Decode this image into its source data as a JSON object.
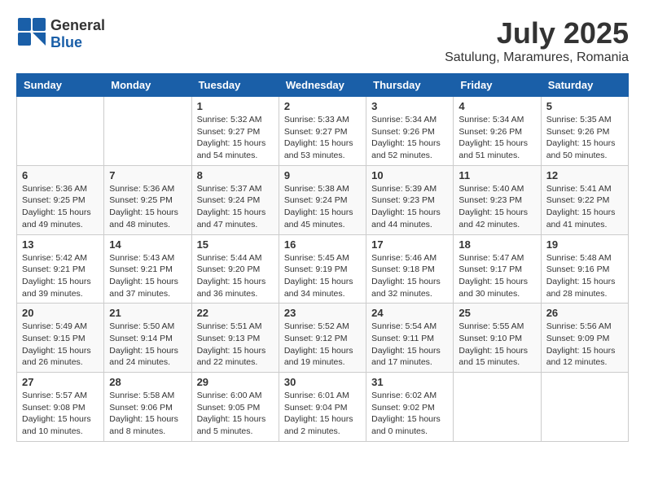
{
  "header": {
    "logo_general": "General",
    "logo_blue": "Blue",
    "month_year": "July 2025",
    "location": "Satulung, Maramures, Romania"
  },
  "weekdays": [
    "Sunday",
    "Monday",
    "Tuesday",
    "Wednesday",
    "Thursday",
    "Friday",
    "Saturday"
  ],
  "weeks": [
    [
      {
        "day": "",
        "info": ""
      },
      {
        "day": "",
        "info": ""
      },
      {
        "day": "1",
        "info": "Sunrise: 5:32 AM\nSunset: 9:27 PM\nDaylight: 15 hours and 54 minutes."
      },
      {
        "day": "2",
        "info": "Sunrise: 5:33 AM\nSunset: 9:27 PM\nDaylight: 15 hours and 53 minutes."
      },
      {
        "day": "3",
        "info": "Sunrise: 5:34 AM\nSunset: 9:26 PM\nDaylight: 15 hours and 52 minutes."
      },
      {
        "day": "4",
        "info": "Sunrise: 5:34 AM\nSunset: 9:26 PM\nDaylight: 15 hours and 51 minutes."
      },
      {
        "day": "5",
        "info": "Sunrise: 5:35 AM\nSunset: 9:26 PM\nDaylight: 15 hours and 50 minutes."
      }
    ],
    [
      {
        "day": "6",
        "info": "Sunrise: 5:36 AM\nSunset: 9:25 PM\nDaylight: 15 hours and 49 minutes."
      },
      {
        "day": "7",
        "info": "Sunrise: 5:36 AM\nSunset: 9:25 PM\nDaylight: 15 hours and 48 minutes."
      },
      {
        "day": "8",
        "info": "Sunrise: 5:37 AM\nSunset: 9:24 PM\nDaylight: 15 hours and 47 minutes."
      },
      {
        "day": "9",
        "info": "Sunrise: 5:38 AM\nSunset: 9:24 PM\nDaylight: 15 hours and 45 minutes."
      },
      {
        "day": "10",
        "info": "Sunrise: 5:39 AM\nSunset: 9:23 PM\nDaylight: 15 hours and 44 minutes."
      },
      {
        "day": "11",
        "info": "Sunrise: 5:40 AM\nSunset: 9:23 PM\nDaylight: 15 hours and 42 minutes."
      },
      {
        "day": "12",
        "info": "Sunrise: 5:41 AM\nSunset: 9:22 PM\nDaylight: 15 hours and 41 minutes."
      }
    ],
    [
      {
        "day": "13",
        "info": "Sunrise: 5:42 AM\nSunset: 9:21 PM\nDaylight: 15 hours and 39 minutes."
      },
      {
        "day": "14",
        "info": "Sunrise: 5:43 AM\nSunset: 9:21 PM\nDaylight: 15 hours and 37 minutes."
      },
      {
        "day": "15",
        "info": "Sunrise: 5:44 AM\nSunset: 9:20 PM\nDaylight: 15 hours and 36 minutes."
      },
      {
        "day": "16",
        "info": "Sunrise: 5:45 AM\nSunset: 9:19 PM\nDaylight: 15 hours and 34 minutes."
      },
      {
        "day": "17",
        "info": "Sunrise: 5:46 AM\nSunset: 9:18 PM\nDaylight: 15 hours and 32 minutes."
      },
      {
        "day": "18",
        "info": "Sunrise: 5:47 AM\nSunset: 9:17 PM\nDaylight: 15 hours and 30 minutes."
      },
      {
        "day": "19",
        "info": "Sunrise: 5:48 AM\nSunset: 9:16 PM\nDaylight: 15 hours and 28 minutes."
      }
    ],
    [
      {
        "day": "20",
        "info": "Sunrise: 5:49 AM\nSunset: 9:15 PM\nDaylight: 15 hours and 26 minutes."
      },
      {
        "day": "21",
        "info": "Sunrise: 5:50 AM\nSunset: 9:14 PM\nDaylight: 15 hours and 24 minutes."
      },
      {
        "day": "22",
        "info": "Sunrise: 5:51 AM\nSunset: 9:13 PM\nDaylight: 15 hours and 22 minutes."
      },
      {
        "day": "23",
        "info": "Sunrise: 5:52 AM\nSunset: 9:12 PM\nDaylight: 15 hours and 19 minutes."
      },
      {
        "day": "24",
        "info": "Sunrise: 5:54 AM\nSunset: 9:11 PM\nDaylight: 15 hours and 17 minutes."
      },
      {
        "day": "25",
        "info": "Sunrise: 5:55 AM\nSunset: 9:10 PM\nDaylight: 15 hours and 15 minutes."
      },
      {
        "day": "26",
        "info": "Sunrise: 5:56 AM\nSunset: 9:09 PM\nDaylight: 15 hours and 12 minutes."
      }
    ],
    [
      {
        "day": "27",
        "info": "Sunrise: 5:57 AM\nSunset: 9:08 PM\nDaylight: 15 hours and 10 minutes."
      },
      {
        "day": "28",
        "info": "Sunrise: 5:58 AM\nSunset: 9:06 PM\nDaylight: 15 hours and 8 minutes."
      },
      {
        "day": "29",
        "info": "Sunrise: 6:00 AM\nSunset: 9:05 PM\nDaylight: 15 hours and 5 minutes."
      },
      {
        "day": "30",
        "info": "Sunrise: 6:01 AM\nSunset: 9:04 PM\nDaylight: 15 hours and 2 minutes."
      },
      {
        "day": "31",
        "info": "Sunrise: 6:02 AM\nSunset: 9:02 PM\nDaylight: 15 hours and 0 minutes."
      },
      {
        "day": "",
        "info": ""
      },
      {
        "day": "",
        "info": ""
      }
    ]
  ]
}
